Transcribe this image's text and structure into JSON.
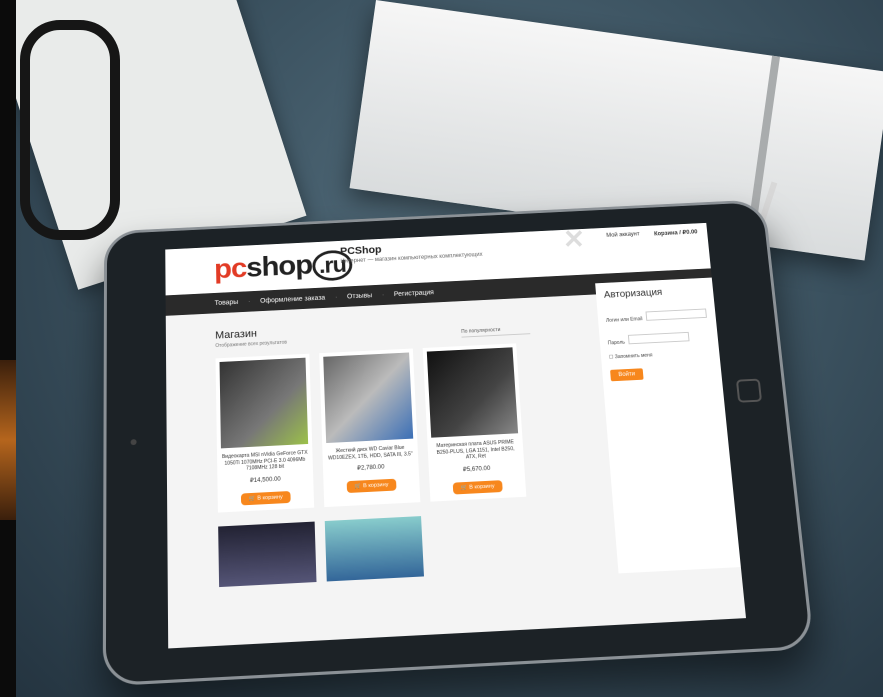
{
  "header": {
    "site_name": "PCShop",
    "tagline": "Интернет — магазин компьютерных комплектующих",
    "account_link": "Мой аккаунт",
    "cart_link": "Корзина / ₽0.00"
  },
  "nav": {
    "items": [
      "Товары",
      "Оформление заказа",
      "Отзывы",
      "Регистрация"
    ]
  },
  "shop": {
    "title": "Магазин",
    "result_count": "Отображение всех результатов",
    "sort_label": "По популярности",
    "products": [
      {
        "title": "Видеокарта MSI nVidia GeForce GTX 1050Ti 1070MHz PCI-E 3.0 4096Mb 7108MHz 128 bit",
        "price": "₽14,500.00",
        "button": "В корзину"
      },
      {
        "title": "Жесткий диск WD Caviar Blue WD10EZEX, 1ТБ, HDD, SATA III, 3.5\"",
        "price": "₽2,780.00",
        "button": "В корзину"
      },
      {
        "title": "Материнская плата ASUS PRIME B250-PLUS, LGA 1151, Intel B250, ATX, Ret",
        "price": "₽5,670.00",
        "button": "В корзину"
      }
    ]
  },
  "sidebar": {
    "title": "Авторизация",
    "login_label": "Логин или Email",
    "password_label": "Пароль",
    "remember_label": "Запомнить меня",
    "submit_label": "Войти"
  },
  "colors": {
    "accent": "#f7871d",
    "logo_red": "#e23b25",
    "nav_bg": "#2a2a2a"
  },
  "icons": {
    "close": "close-icon",
    "cart": "cart-icon",
    "home_button": "home-button-icon"
  }
}
